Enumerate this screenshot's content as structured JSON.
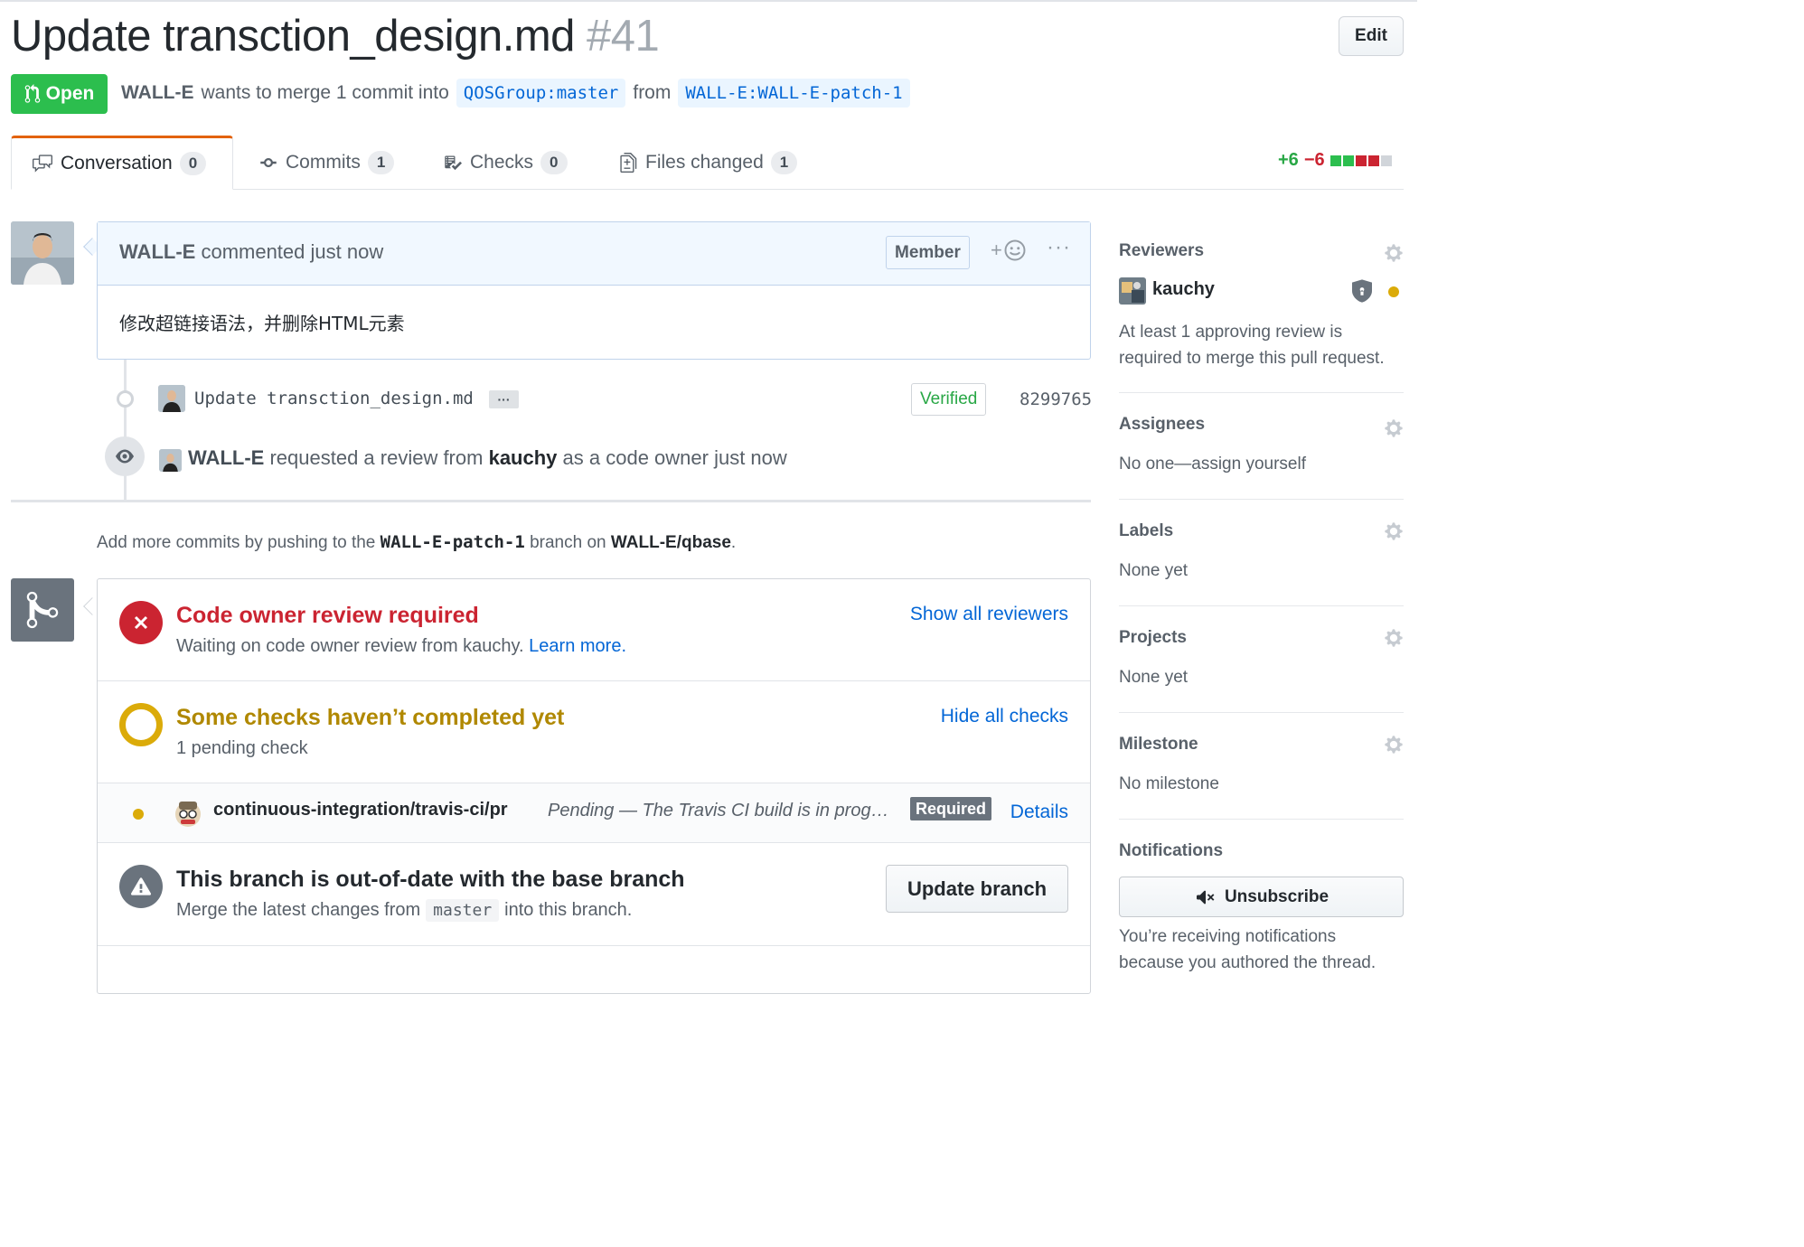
{
  "header": {
    "title": "Update transction_design.md",
    "number": "#41",
    "edit_label": "Edit",
    "state_label": "Open",
    "author": "WALL-E",
    "merge_text": "wants to merge 1 commit into",
    "base_ref": "QOSGroup:master",
    "from_text": "from",
    "head_ref": "WALL-E:WALL-E-patch-1"
  },
  "tabs": [
    {
      "label": "Conversation",
      "count": "0"
    },
    {
      "label": "Commits",
      "count": "1"
    },
    {
      "label": "Checks",
      "count": "0"
    },
    {
      "label": "Files changed",
      "count": "1"
    }
  ],
  "diffstat": {
    "additions": "+6",
    "deletions": "−6"
  },
  "comment": {
    "author": "WALL-E",
    "action": "commented just now",
    "role_badge": "Member",
    "body": "修改超链接语法，并删除HTML元素"
  },
  "timeline": {
    "commit_message": "Update transction_design.md",
    "commit_more": "···",
    "verified_label": "Verified",
    "commit_sha": "8299765",
    "review_author": "WALL-E",
    "review_text_1": "requested a review from",
    "review_reviewer": "kauchy",
    "review_text_2": "as a code owner just now"
  },
  "hint": {
    "prefix": "Add more commits by pushing to the",
    "branch": "WALL-E-patch-1",
    "middle": "branch on",
    "repo": "WALL-E/qbase",
    "suffix": "."
  },
  "merge_box": {
    "review": {
      "title": "Code owner review required",
      "subtitle": "Waiting on code owner review from kauchy.",
      "learn_more": "Learn more.",
      "link": "Show all reviewers",
      "color": "#cb2431"
    },
    "checks": {
      "title": "Some checks haven’t completed yet",
      "subtitle": "1 pending check",
      "link": "Hide all checks",
      "color": "#dbab09"
    },
    "check_item": {
      "name": "continuous-integration/travis-ci/pr",
      "status": "Pending — The Travis CI build is in prog…",
      "required_label": "Required",
      "details_label": "Details"
    },
    "outdated": {
      "title": "This branch is out-of-date with the base branch",
      "subtitle_prefix": "Merge the latest changes from",
      "subtitle_code": "master",
      "subtitle_suffix": "into this branch.",
      "button": "Update branch"
    }
  },
  "sidebar": {
    "reviewers": {
      "heading": "Reviewers",
      "name": "kauchy",
      "note_line1": "At least 1 approving review is",
      "note_line2": "required to merge this pull request."
    },
    "assignees": {
      "heading": "Assignees",
      "value": "No one—assign yourself"
    },
    "labels": {
      "heading": "Labels",
      "value": "None yet"
    },
    "projects": {
      "heading": "Projects",
      "value": "None yet"
    },
    "milestone": {
      "heading": "Milestone",
      "value": "No milestone"
    },
    "notifications": {
      "heading": "Notifications",
      "button": "Unsubscribe",
      "note_line1": "You’re receiving notifications",
      "note_line2": "because you authored the thread."
    }
  },
  "colors": {
    "open_green": "#2cbe4e",
    "link_blue": "#0366d6",
    "error_red": "#cb2431",
    "pending_yellow": "#dbab09"
  }
}
